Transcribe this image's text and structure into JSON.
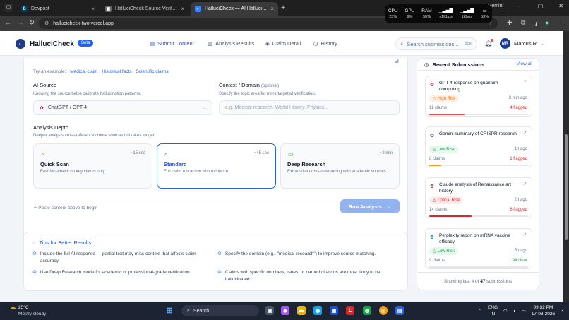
{
  "browser": {
    "tabs": [
      {
        "title": "Devpost",
        "favicon": "D",
        "color": "#003e54",
        "active": false
      },
      {
        "title": "HalluciCheck Source Verificatio",
        "favicon": "▣",
        "color": "#555555",
        "active": false
      },
      {
        "title": "HalluciCheck — AI Hallucinatio",
        "favicon": "◐",
        "color": "#1e3a8a",
        "active": true
      }
    ],
    "url": "hallucicheck-two.vercel.app",
    "perf": [
      {
        "label": "CPU",
        "value": "23%"
      },
      {
        "label": "GPU",
        "value": "9%"
      },
      {
        "label": "RAM",
        "value": "55%"
      },
      {
        "label": "▁▃▅▇",
        "value": "≤1Kbps"
      },
      {
        "label": "▁▃▅▇",
        "value": "1Kbps"
      },
      {
        "label": "▭",
        "value": "53%"
      }
    ],
    "gemini_label": "Gemini"
  },
  "app": {
    "brand": "HalluciCheck",
    "badge": "Beta",
    "nav": [
      {
        "label": "Submit Content",
        "icon": "document-icon",
        "active": true
      },
      {
        "label": "Analysis Results",
        "icon": "bar-chart-icon",
        "active": false
      },
      {
        "label": "Claim Detail",
        "icon": "layers-icon",
        "active": false
      },
      {
        "label": "History",
        "icon": "clock-icon",
        "active": false
      }
    ],
    "search_placeholder": "Search submissions...",
    "search_shortcut": "⌘K",
    "user": {
      "initials": "MR",
      "name": "Marcus R."
    }
  },
  "form": {
    "examples_prefix": "Try an example:",
    "examples": [
      "Medical claim",
      "Historical facts",
      "Scientific claims"
    ],
    "source_label": "AI Source",
    "source_help": "Knowing the source helps calibrate hallucination patterns.",
    "source_value": "ChatGPT / GPT-4",
    "context_label": "Context / Domain",
    "context_optional": "(optional)",
    "context_help": "Specify the topic area for more targeted verification.",
    "context_placeholder": "e.g. Medical research, World History, Physics...",
    "depth_label": "Analysis Depth",
    "depth_help": "Deeper analysis cross-references more sources but takes longer.",
    "depths": [
      {
        "name": "Quick Scan",
        "time": "~15 sec",
        "desc": "Fast fact-check on key claims only",
        "icon": "lightning-icon",
        "color": "#f59e0b",
        "selected": false
      },
      {
        "name": "Standard",
        "time": "~45 sec",
        "desc": "Full claim extraction with evidence",
        "icon": "search-icon",
        "color": "#2563eb",
        "selected": true
      },
      {
        "name": "Deep Research",
        "time": "~2 min",
        "desc": "Exhaustive cross-referencing with academic sources",
        "icon": "book-icon",
        "color": "#16a34a",
        "selected": false
      }
    ],
    "hint": "Paste content above to begin",
    "run_label": "Run Analysis"
  },
  "tips": {
    "title": "Tips for Better Results",
    "items": [
      "Include the full AI response — partial text may miss context that affects claim accuracy.",
      "Specify the domain (e.g., \"medical research\") to improve source matching.",
      "Use Deep Research mode for academic or professional-grade verification.",
      "Claims with specific numbers, dates, or named citations are most likely to be hallucinated."
    ]
  },
  "recent": {
    "title": "Recent Submissions",
    "view_all": "View all",
    "items": [
      {
        "title": "GPT-4 response on quantum computing",
        "risk": "High Risk",
        "time": "3 min ago",
        "claims": "11 claims",
        "flagged": "4 flagged",
        "risk_color": "#f97316",
        "risk_bg": "#fff1e6",
        "icon_color": "#9d174d",
        "bar_pct": 0.36,
        "bar_color": "#ef4444"
      },
      {
        "title": "Gemini summary of CRISPR research",
        "risk": "Low Risk",
        "time": "1h ago",
        "claims": "8 claims",
        "flagged": "1 flagged",
        "risk_color": "#16a34a",
        "risk_bg": "#e8f7ee",
        "icon_color": "#4338ca",
        "bar_pct": 0.12,
        "bar_color": "#f59e0b"
      },
      {
        "title": "Claude analysis of Renaissance art history",
        "risk": "Critical Risk",
        "time": "2h ago",
        "claims": "14 claims",
        "flagged": "6 flagged",
        "risk_color": "#dc2626",
        "risk_bg": "#fdecec",
        "icon_color": "#7c2d12",
        "bar_pct": 0.43,
        "bar_color": "#dc2626"
      },
      {
        "title": "Perplexity report on mRNA vaccine efficacy",
        "risk": "Low Risk",
        "time": "5h ago",
        "claims": "9 claims",
        "flagged": "All clear",
        "risk_color": "#16a34a",
        "risk_bg": "#e8f7ee",
        "icon_color": "#0e7490",
        "bar_pct": 0.0,
        "bar_color": "#16a34a"
      }
    ],
    "footer_prefix": "Showing last 4 of",
    "footer_count": "47",
    "footer_suffix": "submissions"
  },
  "taskbar": {
    "temp": "25°C",
    "weather": "Mostly cloudy",
    "search": "Search",
    "lang1": "ENG",
    "lang2": "IN",
    "time": "09:32 PM",
    "date": "17-08-2026"
  }
}
